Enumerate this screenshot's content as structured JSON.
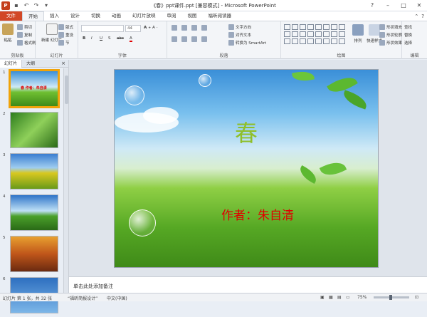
{
  "window": {
    "title": "《春》ppt课件.ppt [兼容模式] - Microsoft PowerPoint",
    "app_icon": "P",
    "controls": [
      "?",
      "–",
      "□",
      "✕"
    ]
  },
  "tabs": [
    {
      "label": "文件"
    },
    {
      "label": "开始"
    },
    {
      "label": "插入"
    },
    {
      "label": "设计"
    },
    {
      "label": "切换"
    },
    {
      "label": "动画"
    },
    {
      "label": "幻灯片放映"
    },
    {
      "label": "审阅"
    },
    {
      "label": "视图"
    },
    {
      "label": "福昕阅读器"
    }
  ],
  "ribbon": {
    "clipboard": {
      "label": "剪贴板",
      "paste": "粘贴",
      "cut": "剪切",
      "copy": "复制",
      "format_painter": "格式刷"
    },
    "slides": {
      "label": "幻灯片",
      "new_slide": "新建\n幻灯片",
      "layout": "版式",
      "reset": "重设",
      "section": "节"
    },
    "font": {
      "label": "字体",
      "size": "44"
    },
    "paragraph": {
      "label": "段落",
      "text_direction": "文字方向",
      "align_text": "对齐文本",
      "smartart": "转换为 SmartArt"
    },
    "drawing": {
      "label": "绘图",
      "arrange": "排列",
      "quick_styles": "快速样式",
      "fill": "形状填充",
      "outline": "形状轮廓",
      "effects": "形状效果"
    },
    "editing": {
      "label": "编辑",
      "find": "查找",
      "replace": "替换",
      "select": "选择"
    }
  },
  "panel": {
    "tab_slides": "幻灯片",
    "tab_outline": "大纲",
    "close": "×",
    "thumbnails": [
      {
        "num": "1",
        "sub": "",
        "text": "春  作者：朱自清",
        "bg": "grass"
      },
      {
        "num": "2",
        "sub": "",
        "text": "",
        "bg": "green"
      },
      {
        "num": "3",
        "sub": "",
        "text": "",
        "bg": "field"
      },
      {
        "num": "4",
        "sub": "",
        "text": "",
        "bg": "sky"
      },
      {
        "num": "5",
        "sub": "",
        "text": "",
        "bg": "autumn"
      },
      {
        "num": "6",
        "sub": "",
        "text": "",
        "bg": "blue"
      }
    ]
  },
  "slide": {
    "title": "春",
    "author": "作者：朱自清"
  },
  "notes": {
    "placeholder": "单击此处添加备注"
  },
  "statusbar": {
    "slide_info": "幻灯片 第 1 张，共 32 张",
    "theme": "“福昕简报设计”",
    "language": "中文(中国)",
    "zoom": "75%"
  }
}
